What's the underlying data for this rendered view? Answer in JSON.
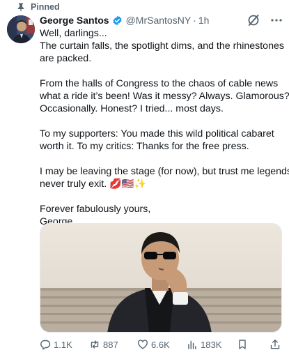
{
  "pinned": {
    "label": "Pinned"
  },
  "author": {
    "name": "George Santos",
    "handle": "@MrSantosNY",
    "time": "1h"
  },
  "tweet": {
    "paragraphs": [
      [
        "Well, darlings...",
        "The curtain falls, the spotlight dims, and the rhinestones",
        "are packed."
      ],
      [
        "From the halls of Congress to the chaos of cable news",
        "what a ride it’s been! Was it messy? Always. Glamorous?",
        "Occasionally. Honest? I tried... most days."
      ],
      [
        "To my supporters: You made this wild political cabaret",
        "worth it. To my critics: Thanks for the free press."
      ],
      [
        "I may be leaving the stage (for now), but trust me legends",
        "never truly exit. 💋🇺🇸✨"
      ],
      [
        "Forever fabulously yours,",
        "George"
      ]
    ]
  },
  "stats": {
    "replies": "1.1K",
    "reposts": "887",
    "likes": "6.6K",
    "views": "183K"
  },
  "colors": {
    "text": "#0f1419",
    "muted": "#536471",
    "verified": "#1d9bf0"
  },
  "icons": [
    "pin-icon",
    "verified-icon",
    "grok-icon",
    "more-icon",
    "reply-icon",
    "repost-icon",
    "like-icon",
    "views-icon",
    "bookmark-icon",
    "share-icon"
  ]
}
